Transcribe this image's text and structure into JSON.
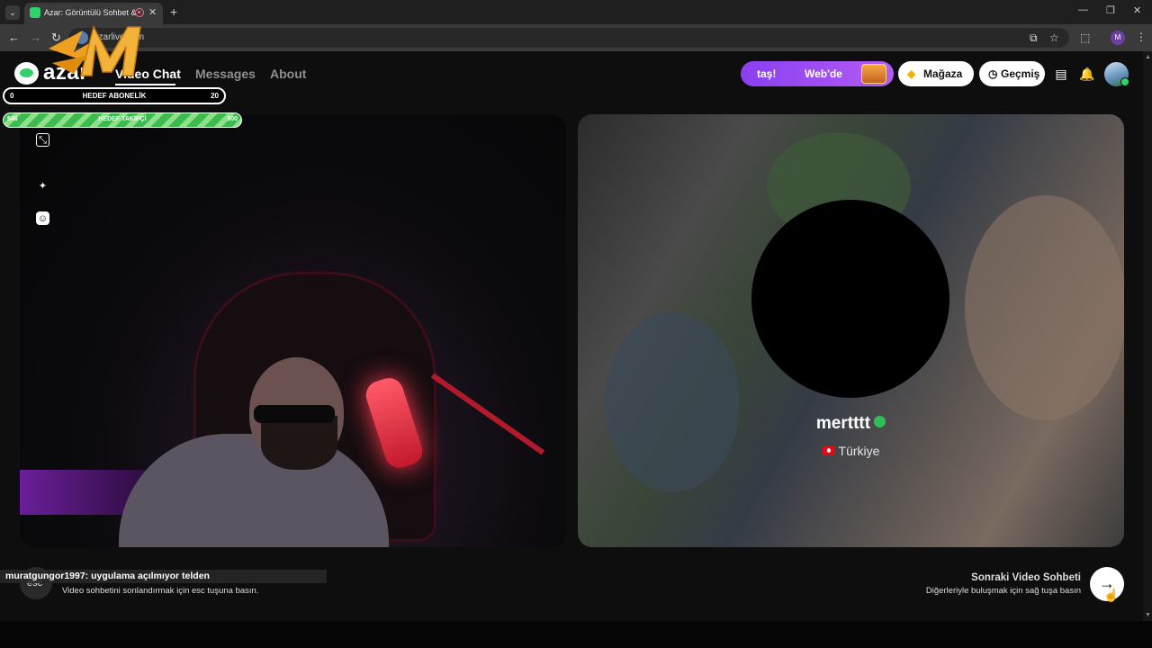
{
  "browser": {
    "tab_title": "Azar: Görüntülü Sohbet & Y",
    "url": "azarlive.com",
    "new_tab": "+",
    "icons": [
      "tab-list-icon",
      "record-icon",
      "close-icon",
      "back-icon",
      "forward-icon",
      "reload-icon",
      "cast-icon",
      "star-icon",
      "extensions-icon",
      "menu-icon"
    ],
    "profile_initial": "M"
  },
  "app": {
    "logo_text": "azar",
    "nav": {
      "video_chat": "Video Chat",
      "messages": "Messages",
      "about": "About"
    },
    "promo": {
      "text_a": "taş!",
      "text_b": "Web'de"
    },
    "store_label": "Mağaza",
    "history_label": "Geçmiş"
  },
  "overlay": {
    "goal_subs": {
      "start": "0",
      "label": "HEDEF ABONELİK",
      "end": "20"
    },
    "goal_follow": {
      "start": "546",
      "label": "HEDEF TAKİPÇİ",
      "end": "500"
    },
    "chat_message": "muratgungor1997: uygulama açılmıyor telden"
  },
  "remote": {
    "name": "mertttt",
    "country": "Türkiye"
  },
  "bottom": {
    "esc_label": "esc",
    "esc_hint": "Video sohbetini sonlandırmak için esc tuşuna basın.",
    "next_title": "Sonraki Video Sohbeti",
    "next_sub": "Diğerleriyle buluşmak için sağ tuşa basın"
  },
  "colors": {
    "brand_green": "#32d06a",
    "promo_purple": "#8a3ff0"
  }
}
